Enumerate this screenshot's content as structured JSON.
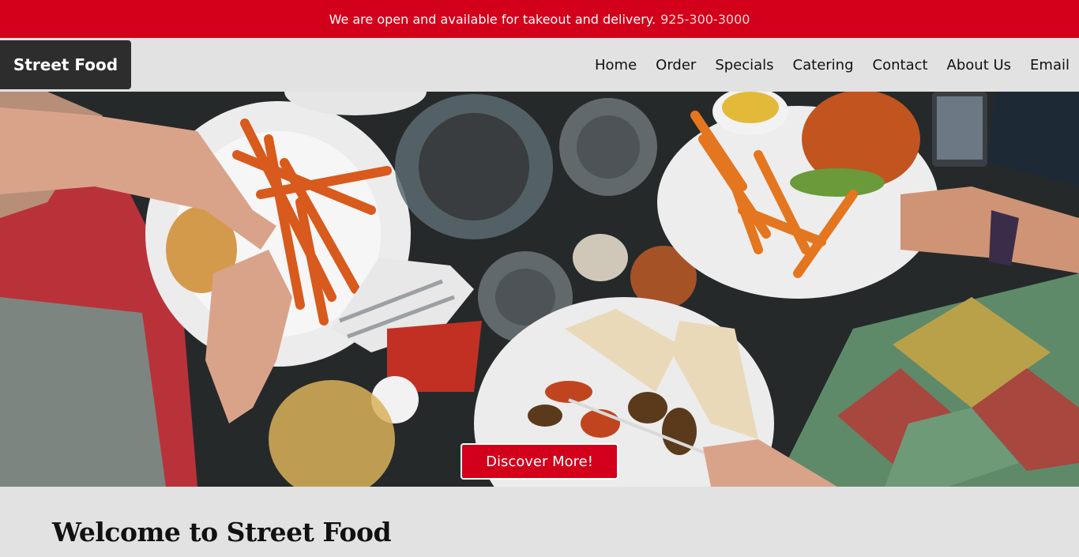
{
  "announcement": {
    "text": "We are open and available for takeout and delivery.",
    "phone": "925-300-3000"
  },
  "brand": {
    "name": "Street Food"
  },
  "nav": {
    "items": [
      "Home",
      "Order",
      "Specials",
      "Catering",
      "Contact",
      "About Us",
      "Email"
    ]
  },
  "hero": {
    "cta_label": "Discover More!"
  },
  "main": {
    "heading": "Welcome to Street Food"
  },
  "colors": {
    "accent": "#d2001a",
    "brand_bg": "#2d2d2d",
    "page_bg": "#e2e2e2"
  }
}
